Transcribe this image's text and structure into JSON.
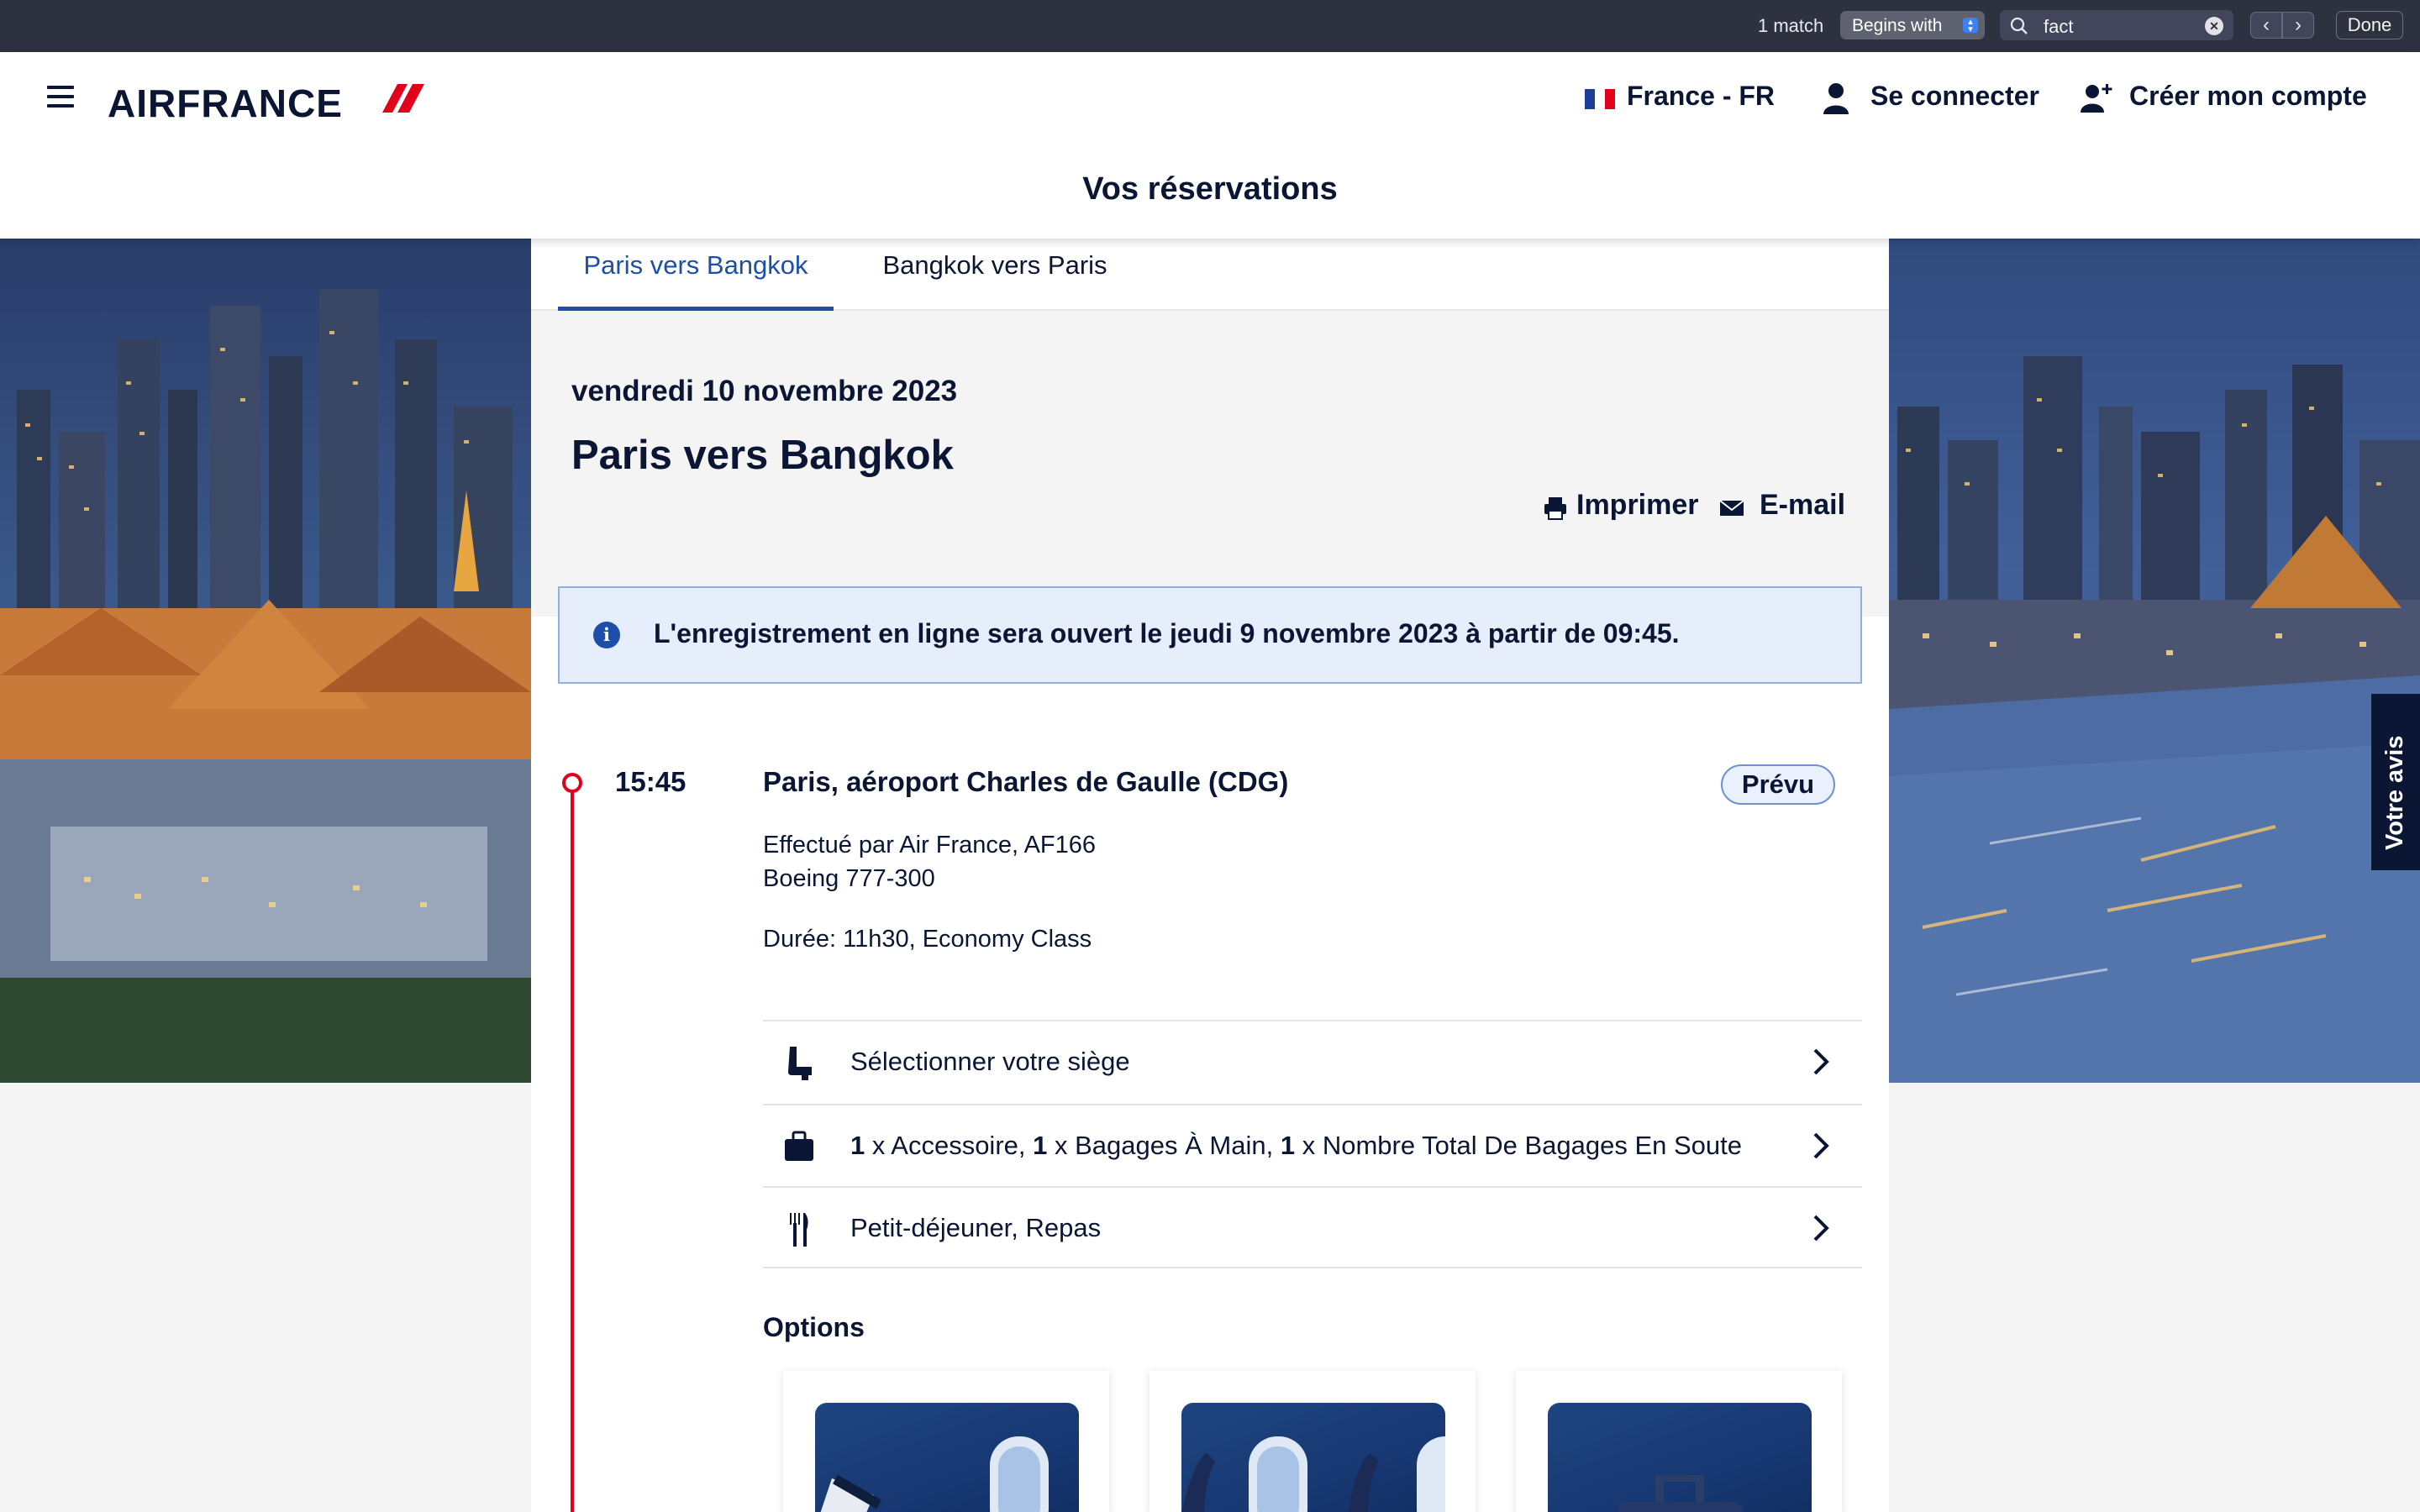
{
  "find_bar": {
    "match_count": "1 match",
    "mode": "Begins with",
    "query": "fact",
    "done_label": "Done"
  },
  "header": {
    "logo_text": "AIRFRANCE",
    "locale": "France - FR",
    "sign_in": "Se connecter",
    "create_account": "Créer mon compte",
    "page_title": "Vos réservations"
  },
  "tabs": [
    {
      "label": "Paris vers Bangkok",
      "active": true
    },
    {
      "label": "Bangkok vers Paris",
      "active": false
    }
  ],
  "summary": {
    "date": "vendredi 10 novembre 2023",
    "route": "Paris vers Bangkok",
    "print_label": "Imprimer",
    "email_label": "E-mail"
  },
  "info": {
    "text": "L'enregistrement en ligne sera ouvert le jeudi 9 novembre 2023 à partir de 09:45."
  },
  "flight": {
    "departure_time": "15:45",
    "departure_airport": "Paris, aéroport Charles de Gaulle (CDG)",
    "status": "Prévu",
    "operated_by": "Effectué par Air France, AF166",
    "aircraft": "Boeing 777-300",
    "duration_class": "Durée: 11h30, Economy Class"
  },
  "services": {
    "seat": "Sélectionner votre siège",
    "baggage": {
      "acc_qty": "1",
      "acc_text": "x Accessoire,",
      "hand_qty": "1",
      "hand_text": "x Bagages À Main,",
      "hold_qty": "1",
      "hold_text": "x Nombre Total De Bagages En Soute"
    },
    "meals": "Petit-déjeuner, Repas"
  },
  "options_title": "Options",
  "feedback_label": "Votre avis",
  "colors": {
    "navy": "#0a1633",
    "accent_blue": "#1d4fa8",
    "timeline_red": "#e2001a",
    "info_bg": "#e6eefb"
  }
}
